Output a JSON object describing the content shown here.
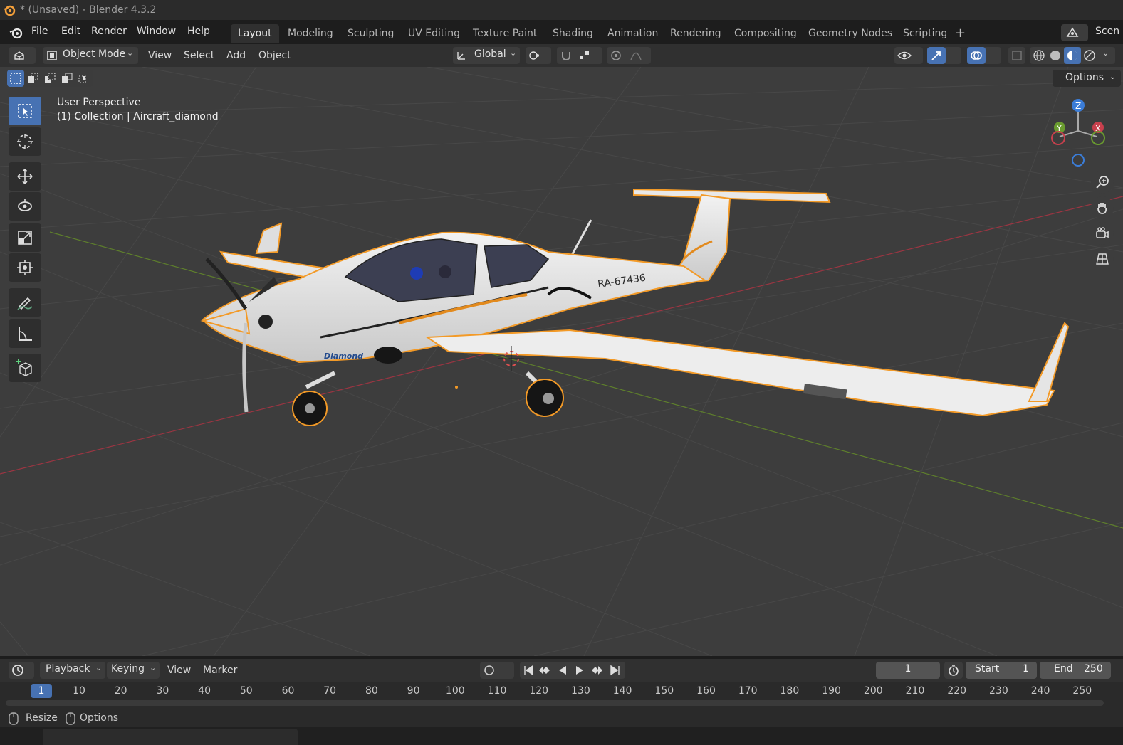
{
  "window": {
    "title": "* (Unsaved) - Blender 4.3.2"
  },
  "menu": {
    "file": "File",
    "edit": "Edit",
    "render": "Render",
    "window": "Window",
    "help": "Help"
  },
  "workspaces": [
    "Layout",
    "Modeling",
    "Sculpting",
    "UV Editing",
    "Texture Paint",
    "Shading",
    "Animation",
    "Rendering",
    "Compositing",
    "Geometry Nodes",
    "Scripting"
  ],
  "scene_label": "Scen",
  "header": {
    "mode": "Object Mode",
    "view": "View",
    "select": "Select",
    "add": "Add",
    "object": "Object",
    "orientation": "Global",
    "options": "Options"
  },
  "viewport": {
    "overlay_line1": "User Perspective",
    "overlay_line2": "(1) Collection | Aircraft_diamond",
    "aircraft_reg": "RA-67436",
    "aircraft_brand": "Diamond",
    "gizmo": {
      "z": "Z",
      "y": "Y",
      "x": "X"
    }
  },
  "timeline": {
    "playback": "Playback",
    "keying": "Keying",
    "view": "View",
    "marker": "Marker",
    "current_frame": "1",
    "start_label": "Start",
    "start": "1",
    "end_label": "End",
    "end": "250",
    "ticks": [
      "1",
      "10",
      "20",
      "30",
      "40",
      "50",
      "60",
      "70",
      "80",
      "90",
      "100",
      "110",
      "120",
      "130",
      "140",
      "150",
      "160",
      "170",
      "180",
      "190",
      "200",
      "210",
      "220",
      "230",
      "240",
      "250"
    ]
  },
  "status": {
    "resize": "Resize",
    "options": "Options"
  },
  "colors": {
    "accent": "#4772b3",
    "selection_outline": "#f39a27",
    "x_axis": "#c8404d",
    "y_axis": "#6a9c2f",
    "z_axis": "#3b7dd8"
  }
}
